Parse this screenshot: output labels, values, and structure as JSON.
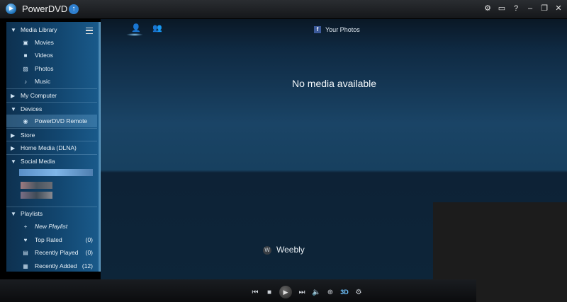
{
  "app": {
    "title": "PowerDVD"
  },
  "titlebar_icons": [
    {
      "name": "settings-icon",
      "glyph": "⚙"
    },
    {
      "name": "tv-icon",
      "glyph": "▭"
    },
    {
      "name": "help-icon",
      "glyph": "?"
    },
    {
      "name": "minimize-icon",
      "glyph": "–"
    },
    {
      "name": "restore-icon",
      "glyph": "❐"
    },
    {
      "name": "close-icon",
      "glyph": "✕"
    }
  ],
  "sidebar": {
    "media_library": {
      "label": "Media Library",
      "items": [
        {
          "label": "Movies",
          "icon": "▣"
        },
        {
          "label": "Videos",
          "icon": "■"
        },
        {
          "label": "Photos",
          "icon": "▨"
        },
        {
          "label": "Music",
          "icon": "♪"
        }
      ]
    },
    "my_computer": "My Computer",
    "devices": {
      "label": "Devices",
      "items": [
        {
          "label": "PowerDVD Remote",
          "icon": "◉"
        }
      ]
    },
    "store": "Store",
    "home_media": "Home Media (DLNA)",
    "social_media": "Social Media",
    "playlists": {
      "label": "Playlists",
      "items": [
        {
          "label": "New Playlist",
          "icon": "+",
          "count": ""
        },
        {
          "label": "Top Rated",
          "icon": "♥",
          "count": "(0)"
        },
        {
          "label": "Recently Played",
          "icon": "▤",
          "count": "(0)"
        },
        {
          "label": "Recently Added",
          "icon": "▦",
          "count": "(12)"
        }
      ]
    }
  },
  "main": {
    "tab_title": "Your Photos",
    "fb_glyph": "f",
    "empty_message": "No media available",
    "watermark": "Weebly",
    "watermark_glyph": "W"
  },
  "player_controls": [
    {
      "name": "previous-icon",
      "glyph": "⏮"
    },
    {
      "name": "stop-icon",
      "glyph": "■"
    },
    {
      "name": "play-icon",
      "glyph": "▶"
    },
    {
      "name": "next-icon",
      "glyph": "⏭"
    },
    {
      "name": "volume-icon",
      "glyph": "🔈"
    },
    {
      "name": "zoom-icon",
      "glyph": "⊕"
    },
    {
      "name": "3d-icon",
      "glyph": "3D"
    },
    {
      "name": "settings-gear-icon",
      "glyph": "⚙"
    }
  ]
}
